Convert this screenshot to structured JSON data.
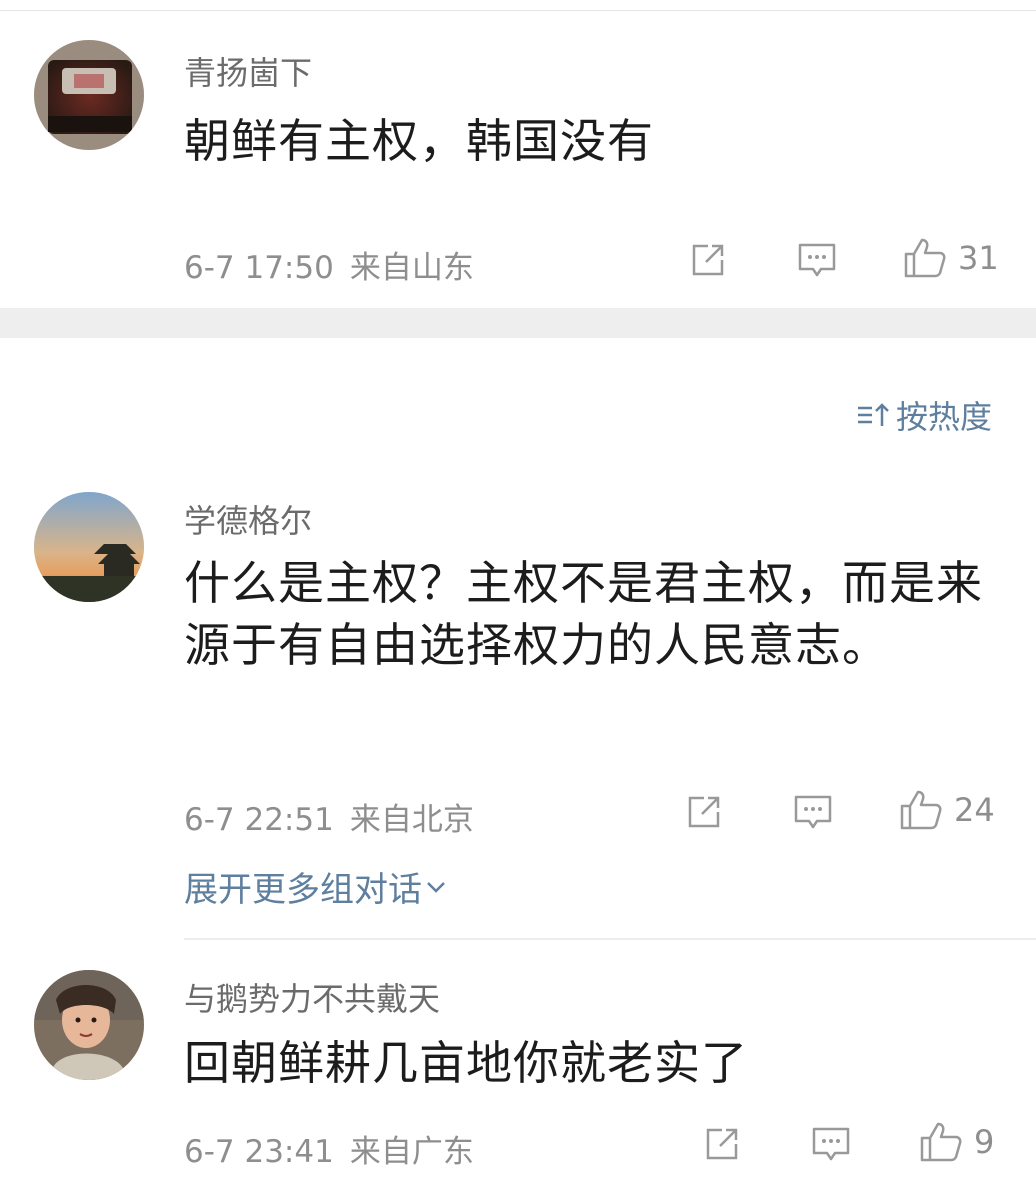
{
  "comments": [
    {
      "username": "青扬崮下",
      "text": "朝鲜有主权，韩国没有",
      "time": "6-7 17:50",
      "location": "来自山东",
      "likes": "31"
    },
    {
      "username": "学德格尔",
      "text": "什么是主权？主权不是君主权，而是来源于有自由选择权力的人民意志。",
      "time": "6-7 22:51",
      "location": "来自北京",
      "likes": "24"
    },
    {
      "username": "与鹅势力不共戴天",
      "text": "回朝鲜耕几亩地你就老实了",
      "time": "6-7 23:41",
      "location": "来自广东",
      "likes": "9"
    }
  ],
  "sort_label": "按热度",
  "expand_label": "展开更多组对话",
  "icons": {
    "share": "share-icon",
    "comment": "comment-icon",
    "like": "thumbs-up-icon",
    "sort": "sort-icon",
    "expand": "chevron-down-icon"
  },
  "colors": {
    "link": "#5f7f9f",
    "meta": "#8e8e8e",
    "text": "#1c1c1c"
  }
}
